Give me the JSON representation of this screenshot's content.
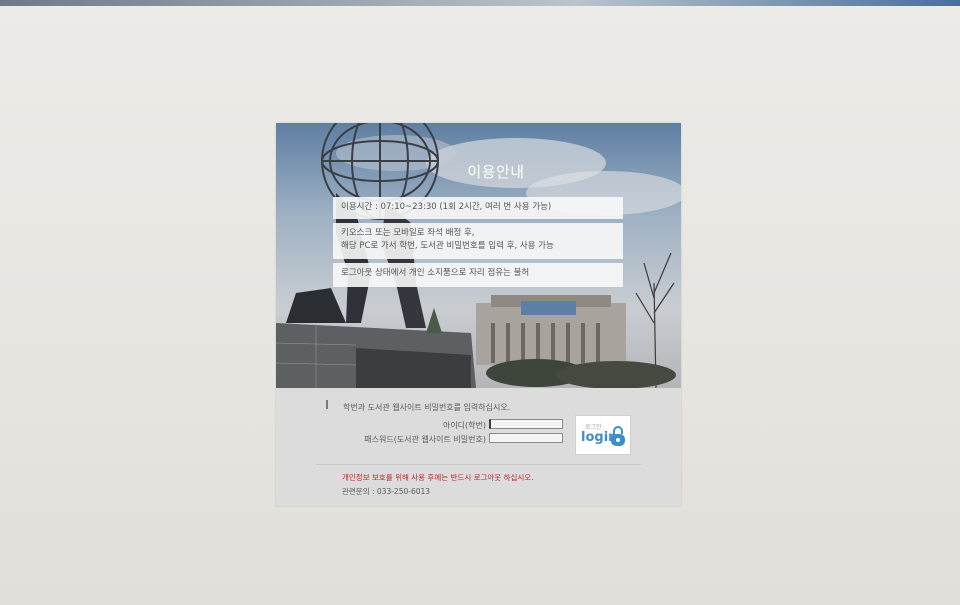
{
  "notice": {
    "title": "이용안내",
    "hours": "이용시간 : 07:10~23:30 (1회 2시간, 여러 번 사용 가능)",
    "instructions_line1": "키오스크 또는 모바일로 좌석 배정 후,",
    "instructions_line2": "해당 PC로 가서 학번, 도서관 비밀번호를 입력 후, 사용 가능",
    "warning_seat": "로그아웃 상태에서 개인 소지품으로 자리 점유는 불허"
  },
  "login": {
    "instruction": "학번과 도서관 웹사이트 비밀번호를 입력하십시오.",
    "id_label": "아이디(학번)",
    "id_value": "",
    "password_label": "패스워드(도서관 웹사이트 비밀번호)",
    "password_value": "",
    "button_small": "로그인",
    "button_label": "login",
    "privacy_warning": "개인정보 보호를 위해 사용 후에는 반드시 로그아웃 하십시오.",
    "contact": "관련문의 : 033-250-6013"
  },
  "colors": {
    "warning": "#c0262b",
    "login_accent": "#3d8fc9"
  }
}
